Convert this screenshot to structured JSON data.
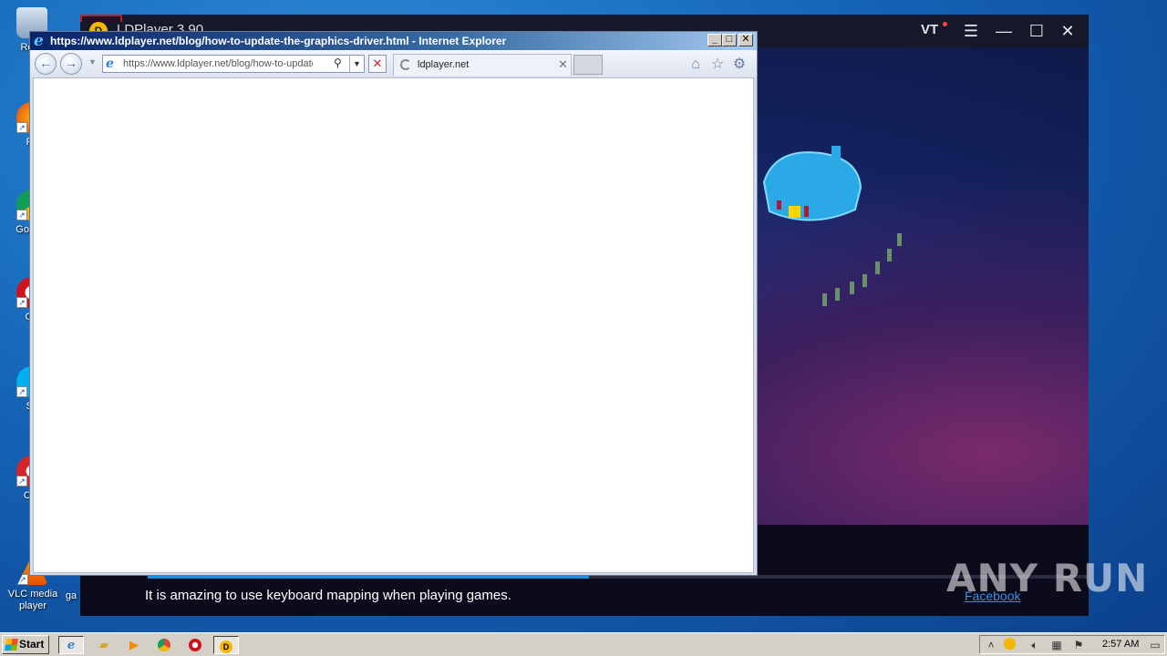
{
  "desktop": {
    "icons": [
      {
        "label": "Recy",
        "icon": "recycle-bin-icon"
      },
      {
        "label": "Fir",
        "icon": "firefox-icon"
      },
      {
        "label": "Go Chr",
        "icon": "chrome-icon"
      },
      {
        "label": "Op",
        "icon": "opera-icon"
      },
      {
        "label": "Sk",
        "icon": "skype-icon"
      },
      {
        "label": "CCl",
        "icon": "ccleaner-icon"
      },
      {
        "label": "VLC media player",
        "icon": "vlc-icon"
      },
      {
        "label": "ga",
        "icon": "game-icon"
      }
    ]
  },
  "ldplayer": {
    "title": "LDPlayer 3.90",
    "vt_label": "VT",
    "tip_message": "It is amazing to use keyboard mapping when playing games.",
    "facebook_link": "Facebook",
    "progress_fraction": 0.47,
    "colors": {
      "accent": "#1f8fe0",
      "vt_dot": "#ff4444"
    }
  },
  "ie": {
    "window_title": "https://www.ldplayer.net/blog/how-to-update-the-graphics-driver.html - Internet Explorer",
    "address_value": "https://www.ldplayer.net/blog/how-to-update-",
    "tab_label": "ldplayer.net",
    "title_buttons": {
      "minimize": "_",
      "maximize": "□",
      "close": "✕"
    }
  },
  "watermark": "ANY RUN",
  "taskbar": {
    "start_label": "Start",
    "apps": [
      "ie-icon",
      "explorer-icon",
      "media-player-icon",
      "chrome-icon",
      "opera-icon",
      "ldplayer-icon"
    ],
    "clock": "2:57 AM"
  }
}
